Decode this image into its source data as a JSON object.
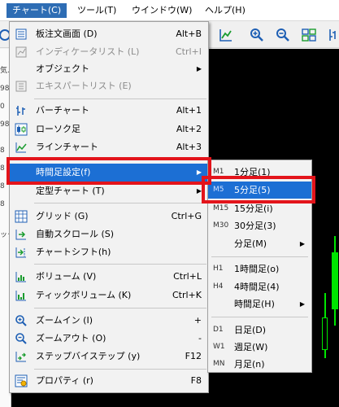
{
  "menubar": {
    "items": [
      {
        "label": "チャート(C)"
      },
      {
        "label": "ツール(T)"
      },
      {
        "label": "ウインドウ(W)"
      },
      {
        "label": "ヘルプ(H)"
      }
    ]
  },
  "navigator": {
    "rows": [
      "気..",
      "98",
      "0",
      "98",
      "8",
      "8",
      "8",
      "8",
      "ック"
    ]
  },
  "chart_menu": {
    "items": [
      {
        "label": "板注文画面 (D)",
        "shortcut": "Alt+B",
        "icon": "order-book-icon",
        "disabled": false
      },
      {
        "label": "インディケータリスト (L)",
        "shortcut": "Ctrl+I",
        "icon": "indicator-list-icon",
        "disabled": true
      },
      {
        "label": "オブジェクト",
        "shortcut": "",
        "icon": "",
        "disabled": false,
        "submenu": true
      },
      {
        "label": "エキスパートリスト (E)",
        "shortcut": "",
        "icon": "expert-list-icon",
        "disabled": true
      },
      {
        "label": "バーチャート",
        "shortcut": "Alt+1",
        "icon": "bar-chart-icon",
        "disabled": false
      },
      {
        "label": "ローソク足",
        "shortcut": "Alt+2",
        "icon": "candlestick-icon",
        "disabled": false
      },
      {
        "label": "ラインチャート",
        "shortcut": "Alt+3",
        "icon": "line-chart-icon",
        "disabled": false
      },
      {
        "label": "時間足設定(f)",
        "shortcut": "",
        "icon": "",
        "disabled": false,
        "submenu": true
      },
      {
        "label": "定型チャート (T)",
        "shortcut": "",
        "icon": "",
        "disabled": false,
        "submenu": true
      },
      {
        "label": "グリッド (G)",
        "shortcut": "Ctrl+G",
        "icon": "grid-icon",
        "disabled": false
      },
      {
        "label": "自動スクロール (S)",
        "shortcut": "",
        "icon": "auto-scroll-icon",
        "disabled": false
      },
      {
        "label": "チャートシフト(h)",
        "shortcut": "",
        "icon": "chart-shift-icon",
        "disabled": false
      },
      {
        "label": "ボリューム (V)",
        "shortcut": "Ctrl+L",
        "icon": "volume-icon",
        "disabled": false
      },
      {
        "label": "ティックボリューム (K)",
        "shortcut": "Ctrl+K",
        "icon": "tick-volume-icon",
        "disabled": false
      },
      {
        "label": "ズームイン (I)",
        "shortcut": "+",
        "icon": "zoom-in-icon",
        "disabled": false
      },
      {
        "label": "ズームアウト (O)",
        "shortcut": "-",
        "icon": "zoom-out-icon",
        "disabled": false
      },
      {
        "label": "ステップバイステップ (y)",
        "shortcut": "F12",
        "icon": "step-by-step-icon",
        "disabled": false
      },
      {
        "label": "プロパティ (r)",
        "shortcut": "F8",
        "icon": "properties-icon",
        "disabled": false
      }
    ]
  },
  "timeframe_menu": {
    "items": [
      {
        "code": "M1",
        "label": "1分足(1)"
      },
      {
        "code": "M5",
        "label": "5分足(5)"
      },
      {
        "code": "M15",
        "label": "15分足(i)"
      },
      {
        "code": "M30",
        "label": "30分足(3)"
      },
      {
        "code": "",
        "label": "分足(M)",
        "submenu": true
      },
      {
        "code": "H1",
        "label": "1時間足(o)"
      },
      {
        "code": "H4",
        "label": "4時間足(4)"
      },
      {
        "code": "",
        "label": "時間足(H)",
        "submenu": true
      },
      {
        "code": "D1",
        "label": "日足(D)"
      },
      {
        "code": "W1",
        "label": "週足(W)"
      },
      {
        "code": "MN",
        "label": "月足(n)"
      }
    ]
  },
  "colors": {
    "highlight": "#1c6fd4",
    "annotation": "#e3141b",
    "chart_background": "#000000",
    "bull_candle": "#00e600"
  }
}
